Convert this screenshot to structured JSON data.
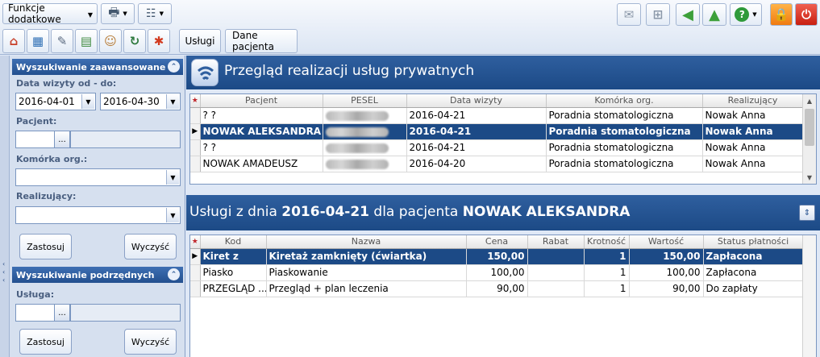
{
  "toolbar": {
    "functions_dropdown": "Funkcje dodatkowe",
    "tab_services": "Usługi",
    "tab_patient_data": "Dane pacjenta"
  },
  "left_panel": {
    "advanced_search": {
      "title": "Wyszukiwanie zaawansowane",
      "date_label": "Data wizyty od - do:",
      "date_from": "2016-04-01",
      "date_to": "2016-04-30",
      "patient_label": "Pacjent:",
      "patient_value": "",
      "unit_label": "Komórka org.:",
      "unit_value": "",
      "performer_label": "Realizujący:",
      "performer_value": "",
      "apply_label": "Zastosuj",
      "clear_label": "Wyczyść"
    },
    "sub_search": {
      "title": "Wyszukiwanie podrzędnych",
      "service_label": "Usługa:",
      "service_value": "",
      "apply_label": "Zastosuj",
      "clear_label": "Wyczyść"
    }
  },
  "visits": {
    "title": "Przegląd realizacji usług prywatnych",
    "columns": [
      "Pacjent",
      "PESEL",
      "Data wizyty",
      "Komórka org.",
      "Realizujący"
    ],
    "rows": [
      {
        "patient": "? ?",
        "date": "2016-04-21",
        "unit": "Poradnia stomatologiczna",
        "performer": "Nowak Anna",
        "selected": false
      },
      {
        "patient": "NOWAK ALEKSANDRA",
        "date": "2016-04-21",
        "unit": "Poradnia stomatologiczna",
        "performer": "Nowak Anna",
        "selected": true
      },
      {
        "patient": "? ?",
        "date": "2016-04-21",
        "unit": "Poradnia stomatologiczna",
        "performer": "Nowak Anna",
        "selected": false
      },
      {
        "patient": "NOWAK AMADEUSZ",
        "date": "2016-04-20",
        "unit": "Poradnia stomatologiczna",
        "performer": "Nowak Anna",
        "selected": false
      }
    ]
  },
  "services": {
    "title_prefix": "Usługi z dnia",
    "title_date": "2016-04-21",
    "title_mid": "dla pacjenta",
    "title_patient": "NOWAK ALEKSANDRA",
    "columns": [
      "Kod",
      "Nazwa",
      "Cena",
      "Rabat",
      "Krotność",
      "Wartość",
      "Status płatności"
    ],
    "rows": [
      {
        "code": "Kiret z",
        "name": "Kiretaż zamknięty (ćwiartka)",
        "price": "150,00",
        "discount": "",
        "qty": "1",
        "value": "150,00",
        "status": "Zapłacona",
        "selected": true
      },
      {
        "code": "Piasko",
        "name": "Piaskowanie",
        "price": "100,00",
        "discount": "",
        "qty": "1",
        "value": "100,00",
        "status": "Zapłacona",
        "selected": false
      },
      {
        "code": "PRZEGLĄD ...",
        "name": "Przegląd + plan leczenia",
        "price": "90,00",
        "discount": "",
        "qty": "1",
        "value": "90,00",
        "status": "Do zapłaty",
        "selected": false
      }
    ]
  },
  "colors": {
    "header_blue": "#1c4a86",
    "selection_blue": "#1c4a86",
    "panel_bg": "#dfe8f6"
  }
}
